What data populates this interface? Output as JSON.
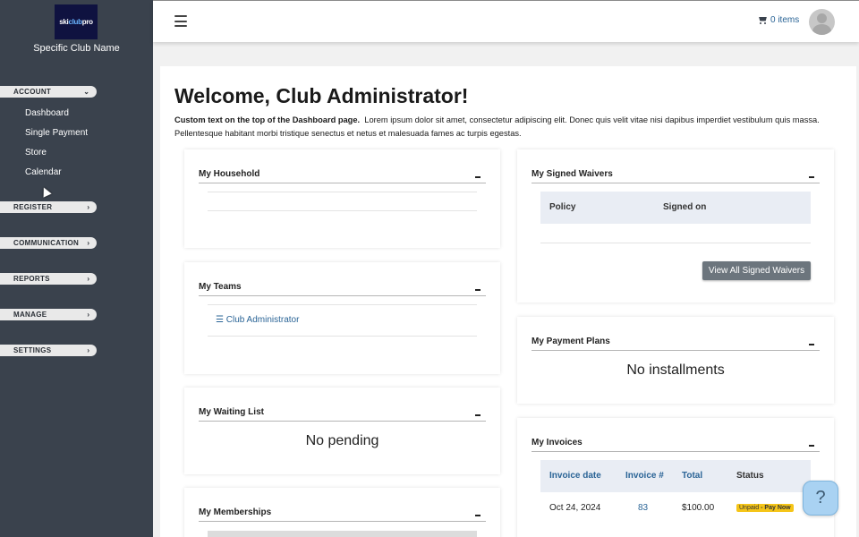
{
  "brand": {
    "logo_text_a": "ski",
    "logo_text_b": "club",
    "logo_text_c": "pro",
    "club_name": "Specific Club Name"
  },
  "sidebar": {
    "sections": [
      {
        "label": "ACCOUNT",
        "chevron": "chevron-down-icon"
      },
      {
        "label": "REGISTER",
        "chevron": "chevron-right-icon"
      },
      {
        "label": "COMMUNICATION",
        "chevron": "chevron-right-icon"
      },
      {
        "label": "REPORTS",
        "chevron": "chevron-right-icon"
      },
      {
        "label": "MANAGE",
        "chevron": "chevron-right-icon"
      },
      {
        "label": "SETTINGS",
        "chevron": "chevron-right-icon"
      }
    ],
    "account_items": [
      "Dashboard",
      "Single Payment",
      "Store",
      "Calendar"
    ]
  },
  "header": {
    "cart_label": "0 items"
  },
  "page": {
    "title": "Welcome, Club Administrator!",
    "intro_bold": "Custom text on the top of the Dashboard page.",
    "intro_text": "Lorem ipsum dolor sit amet, consectetur adipiscing elit. Donec quis velit vitae nisi dapibus imperdiet vestibulum quis massa. Pellentesque habitant morbi tristique senectus et netus et malesuada fames ac turpis egestas."
  },
  "panels": {
    "household": {
      "title": "My Household"
    },
    "teams": {
      "title": "My Teams",
      "items": [
        "Club Administrator"
      ]
    },
    "waiting_list": {
      "title": "My Waiting List",
      "empty_text": "No pending"
    },
    "memberships": {
      "title": "My Memberships"
    },
    "waivers": {
      "title": "My Signed Waivers",
      "columns": [
        "Policy",
        "Signed on"
      ],
      "button": "View All Signed Waivers"
    },
    "payment_plans": {
      "title": "My Payment Plans",
      "empty_text": "No installments"
    },
    "invoices": {
      "title": "My Invoices",
      "columns": [
        "Invoice date",
        "Invoice #",
        "Total",
        "Status"
      ],
      "rows": [
        {
          "date": "Oct 24, 2024",
          "number": "83",
          "total": "$100.00",
          "status": "Unpaid",
          "action": "Pay Now"
        }
      ]
    }
  },
  "help": {
    "label": "?"
  },
  "colors": {
    "sidebar_bg": "#3a424d",
    "link": "#2a6496",
    "badge": "#f5c518",
    "button": "#6c757d"
  }
}
